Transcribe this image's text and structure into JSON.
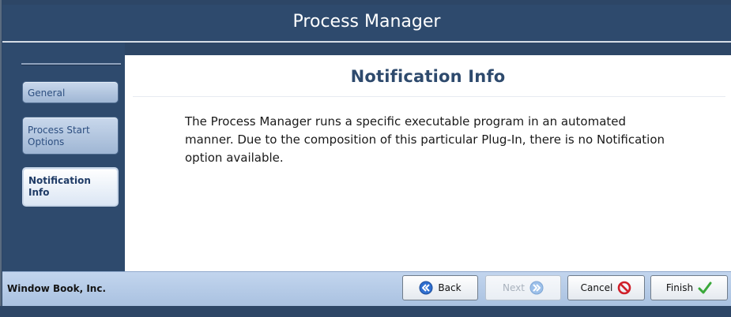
{
  "window": {
    "title": "Process Manager"
  },
  "sidebar": {
    "items": [
      {
        "label": "General",
        "selected": false
      },
      {
        "label_lines": [
          "Process Start",
          "Options"
        ],
        "selected": false
      },
      {
        "label_lines": [
          "Notification",
          "Info"
        ],
        "selected": true
      }
    ]
  },
  "content": {
    "heading": "Notification Info",
    "body": "The Process Manager runs a specific executable program in an automated manner. Due to the composition of this particular Plug-In, there is no Notification option available."
  },
  "footer": {
    "company": "Window Book, Inc.",
    "buttons": {
      "back": {
        "label": "Back",
        "icon": "back-arrow-icon",
        "enabled": true
      },
      "next": {
        "label": "Next",
        "icon": "next-arrow-icon",
        "enabled": false
      },
      "cancel": {
        "label": "Cancel",
        "icon": "cancel-icon",
        "enabled": true
      },
      "finish": {
        "label": "Finish",
        "icon": "checkmark-icon",
        "enabled": true
      }
    }
  },
  "colors": {
    "frame": "#2d4666",
    "accent_text": "#2e4a6d",
    "footer_bg": "#b6cbe7",
    "cancel_red": "#d0202a",
    "finish_green": "#3aa83a"
  }
}
